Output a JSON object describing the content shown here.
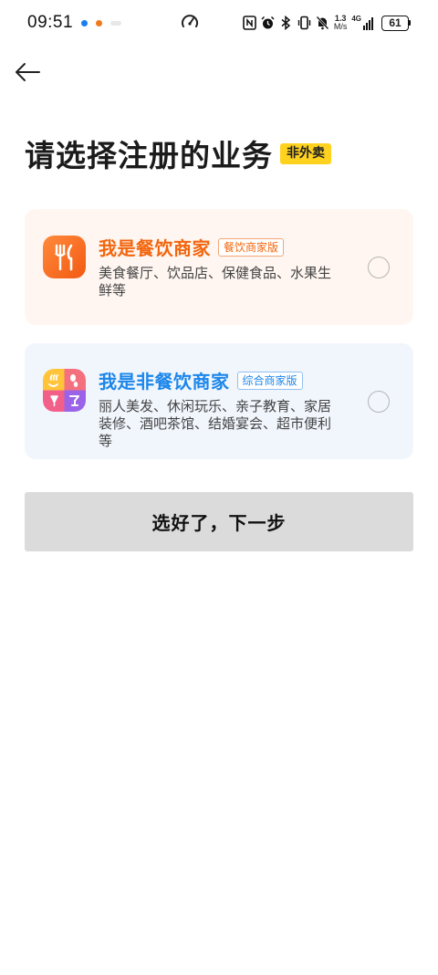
{
  "status_bar": {
    "time": "09:51",
    "net_speed_value": "1.3",
    "net_speed_unit": "M/s",
    "network_type": "4G",
    "battery": "61",
    "icons": [
      "nfc-icon",
      "alarm-icon",
      "bluetooth-icon",
      "vibrate-icon",
      "mute-icon",
      "signal-icon",
      "battery-icon",
      "speedometer-icon"
    ]
  },
  "header": {
    "title": "请选择注册的业务",
    "badge": "非外卖"
  },
  "options": [
    {
      "title": "我是餐饮商家",
      "tag": "餐饮商家版",
      "description": "美食餐厅、饮品店、保健食品、水果生鲜等",
      "icon": "fork-knife-icon",
      "selected": false,
      "accent_color": "#f2660e"
    },
    {
      "title": "我是非餐饮商家",
      "tag": "综合商家版",
      "description": "丽人美发、休闲玩乐、亲子教育、家居装修、酒吧茶馆、结婚宴会、超市便利等",
      "icon": "multi-category-icon",
      "selected": false,
      "accent_color": "#1c86ea"
    }
  ],
  "next_button": {
    "label": "选好了，下一步"
  },
  "colors": {
    "badge_bg": "#ffd21f",
    "catering_card_bg": "#fff6f1",
    "noncatering_card_bg": "#f1f6fd",
    "button_disabled_bg": "#dbdbdb"
  }
}
